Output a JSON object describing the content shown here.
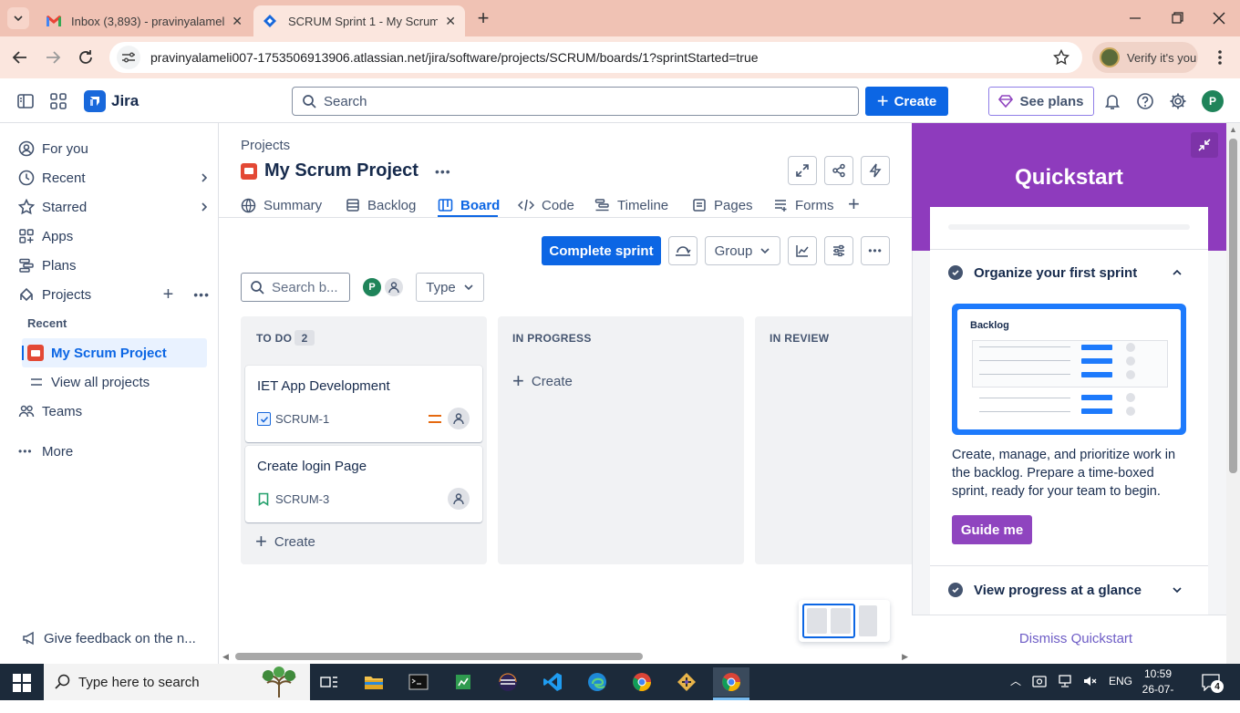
{
  "browser": {
    "tabs": [
      {
        "title": "Inbox (3,893) - pravinyalameli0",
        "active": false
      },
      {
        "title": "SCRUM Sprint 1 - My Scrum Pr",
        "active": true
      }
    ],
    "url": "pravinyalameli007-1753506913906.atlassian.net/jira/software/projects/SCRUM/boards/1?sprintStarted=true",
    "verify_label": "Verify it's you"
  },
  "jira": {
    "product": "Jira",
    "search_placeholder": "Search",
    "create_label": "Create",
    "see_plans_label": "See plans",
    "avatar_initial": "P"
  },
  "sidebar": {
    "items": [
      {
        "label": "For you"
      },
      {
        "label": "Recent"
      },
      {
        "label": "Starred"
      },
      {
        "label": "Apps"
      },
      {
        "label": "Plans"
      },
      {
        "label": "Projects"
      }
    ],
    "recent_heading": "Recent",
    "recent_project": "My Scrum Project",
    "view_all": "View all projects",
    "teams": "Teams",
    "more": "More",
    "feedback": "Give feedback on the n..."
  },
  "project": {
    "breadcrumb": "Projects",
    "name": "My Scrum Project",
    "tabs": [
      "Summary",
      "Backlog",
      "Board",
      "Code",
      "Timeline",
      "Pages",
      "Forms"
    ],
    "active_tab": "Board"
  },
  "board": {
    "complete_sprint": "Complete sprint",
    "group_label": "Group",
    "search_placeholder": "Search b...",
    "type_label": "Type",
    "avatar_initial": "P",
    "columns": [
      {
        "name": "TO DO",
        "count": "2"
      },
      {
        "name": "IN PROGRESS"
      },
      {
        "name": "IN REVIEW"
      }
    ],
    "cards": [
      {
        "title": "IET App Development",
        "key": "SCRUM-1",
        "type": "task"
      },
      {
        "title": "Create login Page",
        "key": "SCRUM-3",
        "type": "story"
      }
    ],
    "create_label": "Create",
    "inprogress_create": "Create"
  },
  "quickstart": {
    "title": "Quickstart",
    "section1_title": "Organize your first sprint",
    "illustration_label": "Backlog",
    "description": "Create, manage, and prioritize work in the backlog. Prepare a time-boxed sprint, ready for your team to begin.",
    "guide_me": "Guide me",
    "section2_title": "View progress at a glance",
    "dismiss": "Dismiss Quickstart"
  },
  "taskbar": {
    "search_placeholder": "Type here to search",
    "language": "ENG",
    "time": "10:59",
    "date": "26-07-2025",
    "notifications": "4"
  },
  "colors": {
    "accent": "#0c66e4",
    "quickstart_purple": "#8e3bbd",
    "guide_purple": "#8f44bf",
    "tab_strip": "#f0c2b4"
  }
}
